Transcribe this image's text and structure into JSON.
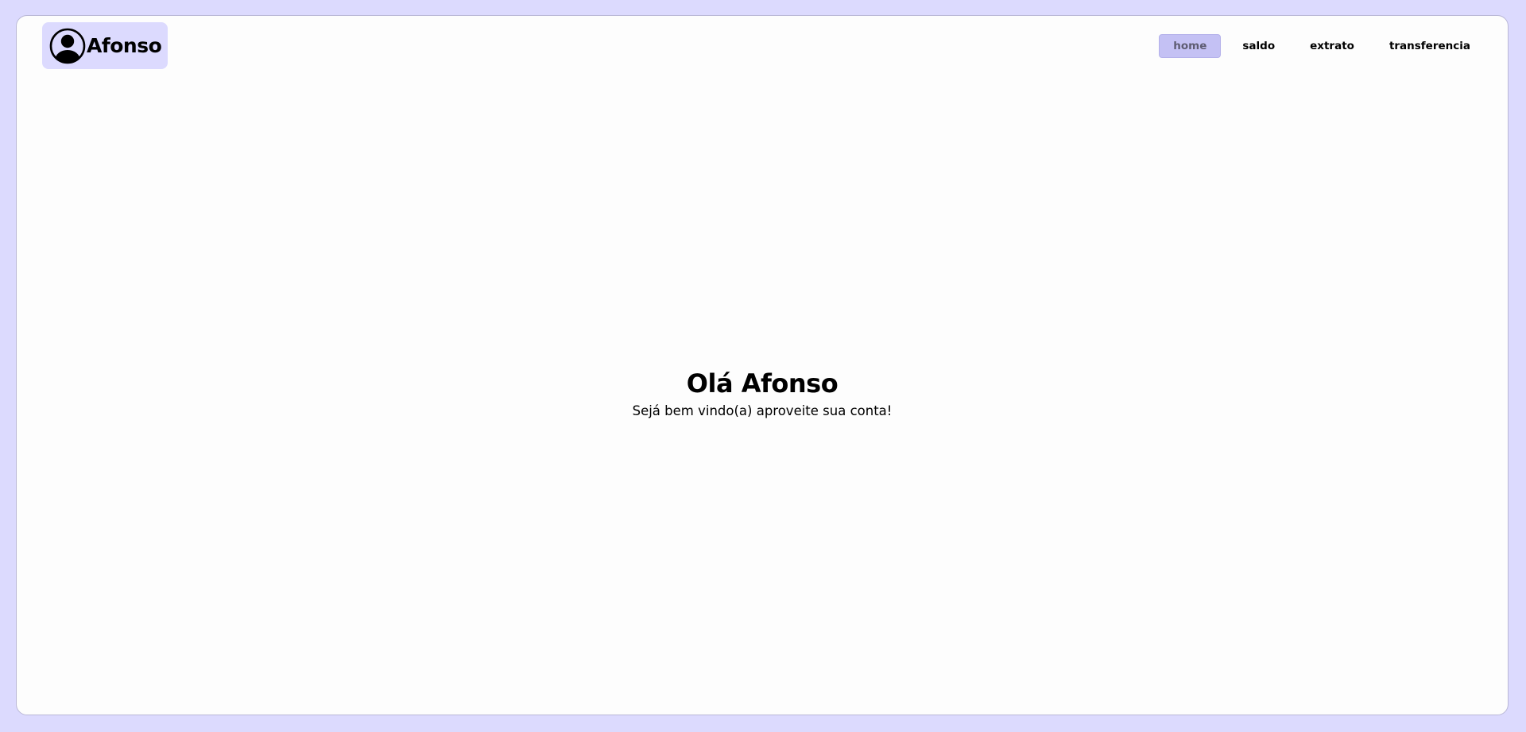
{
  "header": {
    "brand": {
      "icon": "user-circle-icon",
      "name": "Afonso",
      "background": "#dcdafe"
    },
    "nav": [
      {
        "label": "home",
        "active": true
      },
      {
        "label": "saldo",
        "active": false
      },
      {
        "label": "extrato",
        "active": false
      },
      {
        "label": "transferencia",
        "active": false
      }
    ]
  },
  "main": {
    "greeting": "Olá Afonso",
    "subtitle": "Sejá bem vindo(a) aproveite sua conta!"
  },
  "colors": {
    "page_background": "#dcdafe",
    "card_background": "#fdfdfd",
    "active_nav": "#c4c1f4"
  }
}
